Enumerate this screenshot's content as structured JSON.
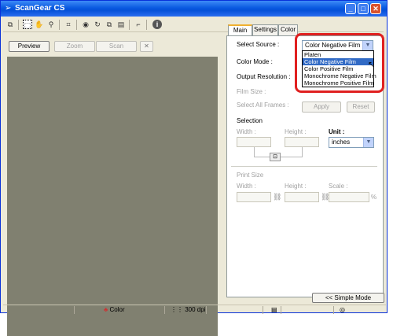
{
  "window": {
    "title": "ScanGear CS",
    "minimize": "_",
    "maximize": "□",
    "close": "✕"
  },
  "toolbar": {
    "icons": [
      "copy-icon",
      "marquee-icon",
      "hand-icon",
      "zoom-icon",
      "crop-icon",
      "eye-icon",
      "rotate-icon",
      "copy2-icon",
      "layers-icon",
      "flip-icon",
      "info-icon"
    ]
  },
  "preview_pane": {
    "preview": "Preview",
    "zoom": "Zoom",
    "scan": "Scan",
    "clear": "✕"
  },
  "tabs": [
    "Main",
    "Settings",
    "Color"
  ],
  "main": {
    "select_source_label": "Select Source :",
    "select_source_value": "Color Negative Film",
    "dropdown_options": [
      "Platen",
      "Color Negative Film",
      "Color Positive Film",
      "Monochrome Negative Film",
      "Monochrome Positive Film"
    ],
    "selected_option_index": 1,
    "color_mode_label": "Color Mode :",
    "output_resolution_label": "Output Resolution :",
    "film_size_label": "Film Size :",
    "select_all_frames_label": "Select All Frames :",
    "apply": "Apply",
    "reset": "Reset",
    "selection_label": "Selection",
    "width_label": "Width :",
    "height_label": "Height :",
    "unit_label": "Unit :",
    "unit_value": "inches",
    "print_size_label": "Print Size",
    "print_width_label": "Width :",
    "print_height_label": "Height :",
    "scale_label": "Scale :",
    "percent": "%",
    "simple_mode": "<< Simple Mode"
  },
  "status": {
    "color": "Color",
    "dpi": "300 dpi"
  }
}
